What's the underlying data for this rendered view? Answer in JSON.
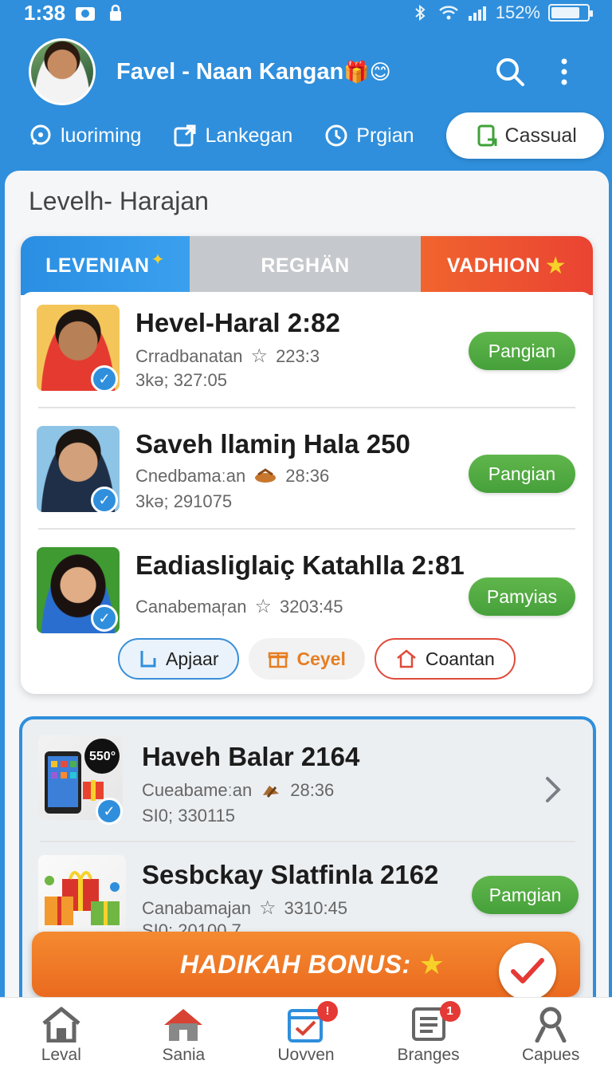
{
  "status_bar": {
    "time": "1:38",
    "battery_text": "152%",
    "battery_level": 0.8
  },
  "header": {
    "title": "Favel - Naan Kangan",
    "title_emoji": "🎁😊"
  },
  "filters": [
    {
      "label": "luoriming",
      "icon": "chat-bubble-icon"
    },
    {
      "label": "Lankegan",
      "icon": "external-link-icon"
    },
    {
      "label": "Prgian",
      "icon": "clock-icon"
    },
    {
      "label": "Cassual",
      "icon": "document-icon",
      "active": true
    }
  ],
  "section": {
    "title": "Levelh- Harajan"
  },
  "level_tabs": {
    "tab1": "LEVENIAN",
    "tab2": "REGHÄN",
    "tab3": "VADHION"
  },
  "people": [
    {
      "name": "Hevel-Haral 2:82",
      "meta": "Crradbanatan",
      "score": "223:3",
      "sub": "3kə; 327:05",
      "action": "Pangian",
      "meta_icon": "star-outline-icon"
    },
    {
      "name": "Saveh llamiŋ Hala 250",
      "meta": "Cnedbamaːan",
      "score": "28:36",
      "sub": "3kə; 291075",
      "action": "Pangian",
      "meta_icon": "snack-icon"
    },
    {
      "name": "Eadiasliglaiç Katahlla 2:81",
      "meta": "Canabemaŗan",
      "score": "3203:45",
      "sub": "",
      "action": "Pamyias",
      "meta_icon": "star-outline-icon"
    }
  ],
  "chips": [
    {
      "label": "Apjaar",
      "icon": "document-icon"
    },
    {
      "label": "Ceyel",
      "icon": "gift-icon"
    },
    {
      "label": "Coantan",
      "icon": "home-icon"
    }
  ],
  "products": [
    {
      "name": "Haveh Balar 2164",
      "meta": "Cueabameːan",
      "score": "28:36",
      "sub": "SI0; 330115",
      "badge": "550°",
      "meta_icon": "snack-icon"
    },
    {
      "name": "Sesbckay Slatfinla 2162",
      "meta": "Canabamajan",
      "score": "3310:45",
      "sub": "SI0; 20100 7",
      "action": "Pamgian",
      "meta_icon": "star-outline-icon"
    }
  ],
  "bonus": {
    "label": "HADIKAH BONUS:"
  },
  "bottom_nav": [
    {
      "label": "Leval",
      "icon": "home-icon"
    },
    {
      "label": "Sania",
      "icon": "house-red-icon"
    },
    {
      "label": "Uovven",
      "icon": "calendar-check-icon",
      "badge": "!"
    },
    {
      "label": "Branges",
      "icon": "list-icon",
      "badge": "1"
    },
    {
      "label": "Capues",
      "icon": "user-icon"
    }
  ],
  "colors": {
    "primary": "#2f8fdc",
    "success": "#4caf3a",
    "accent": "#ea6a1f",
    "danger": "#e53935"
  }
}
